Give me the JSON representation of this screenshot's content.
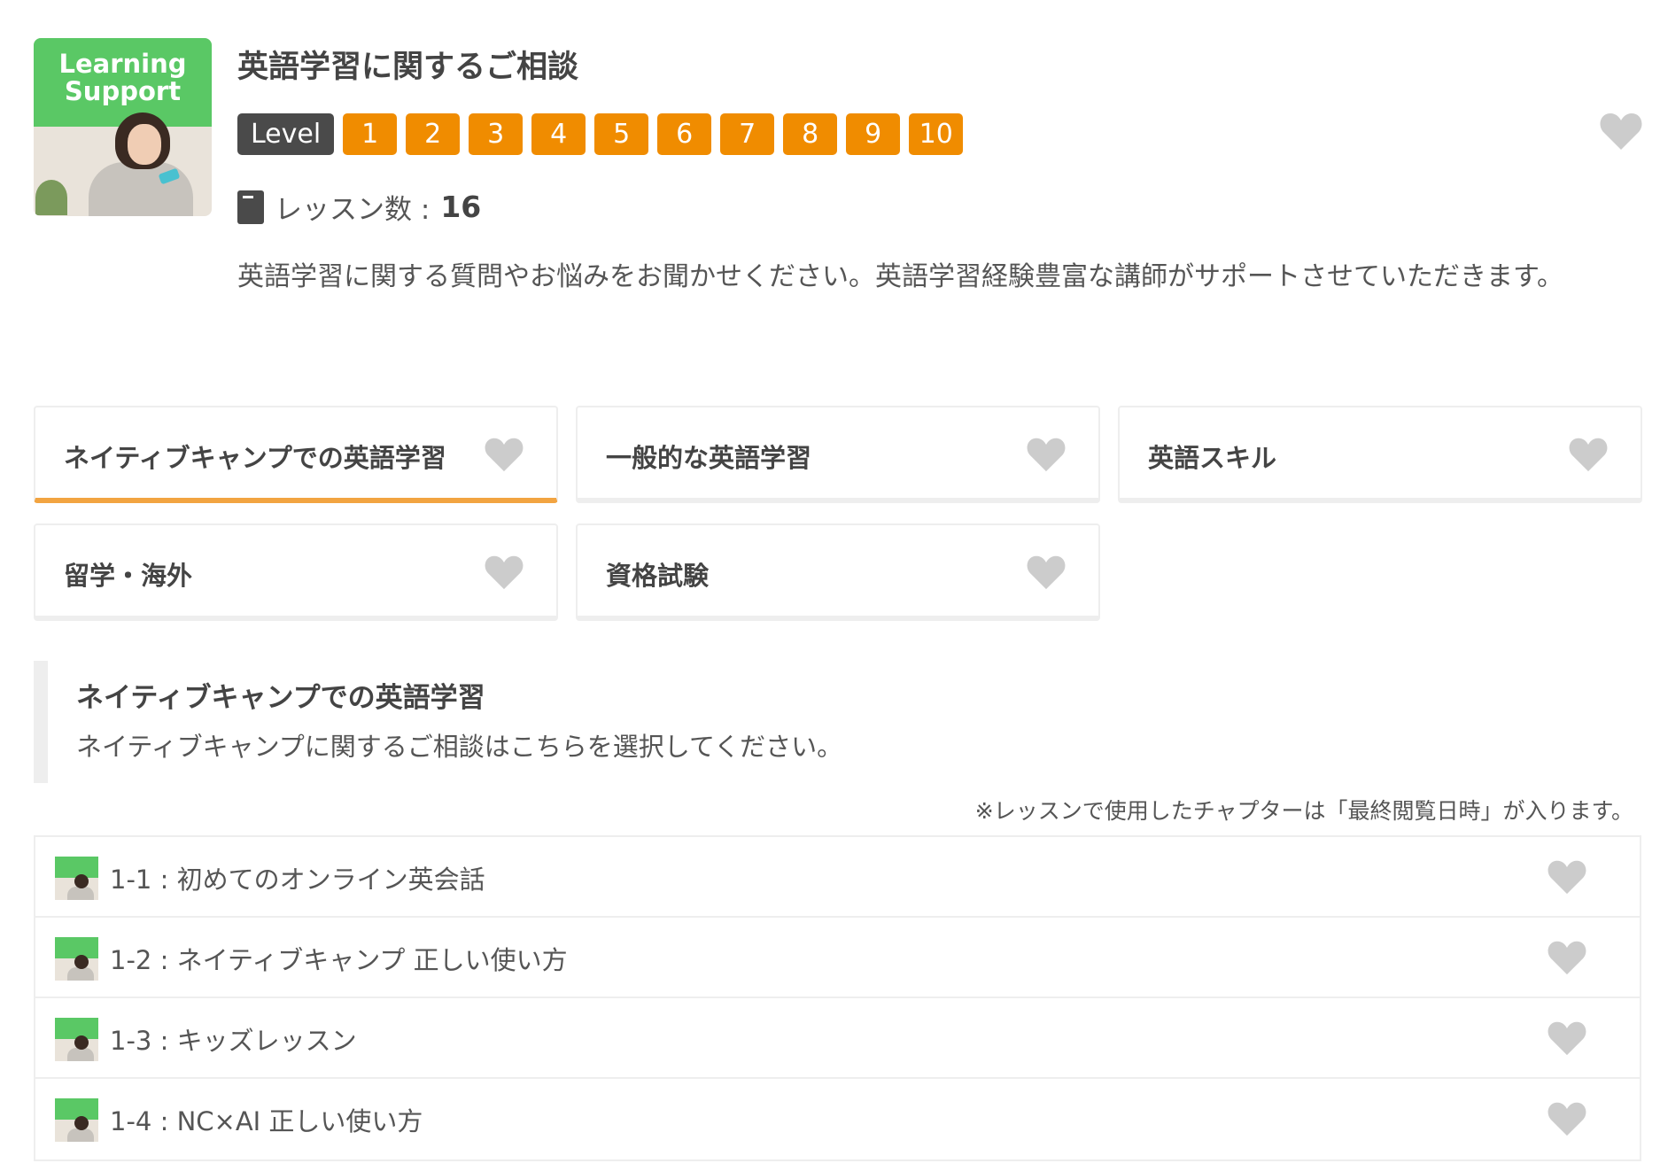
{
  "course": {
    "thumbnail_text": [
      "Learning",
      "Support"
    ],
    "title": "英語学習に関するご相談",
    "level_label": "Level",
    "levels": [
      "1",
      "2",
      "3",
      "4",
      "5",
      "6",
      "7",
      "8",
      "9",
      "10"
    ],
    "lesson_count_label": "レッスン数 : ",
    "lesson_count_value": "16",
    "description": "英語学習に関する質問やお悩みをお聞かせください。英語学習経験豊富な講師がサポートさせていただきます。"
  },
  "categories": [
    {
      "label": "ネイティブキャンプでの英語学習",
      "active": true
    },
    {
      "label": "一般的な英語学習",
      "active": false
    },
    {
      "label": "英語スキル",
      "active": false
    },
    {
      "label": "留学・海外",
      "active": false
    },
    {
      "label": "資格試験",
      "active": false
    }
  ],
  "section": {
    "title": "ネイティブキャンプでの英語学習",
    "description": "ネイティブキャンプに関するご相談はこちらを選択してください。"
  },
  "note": "※レッスンで使用したチャプターは「最終閲覧日時」が入ります。",
  "chapters": [
    {
      "label": "1-1 : 初めてのオンライン英会話"
    },
    {
      "label": "1-2 : ネイティブキャンプ 正しい使い方"
    },
    {
      "label": "1-3 : キッズレッスン"
    },
    {
      "label": "1-4 : NC×AI 正しい使い方"
    }
  ],
  "icons": {
    "favorite": "heart-icon",
    "lessons": "book-icon"
  },
  "colors": {
    "level_badge": "#f08c00",
    "level_label_bg": "#4a4a4a",
    "active_tab_underline": "#f2a441",
    "heart": "#cccccc",
    "thumbnail_green": "#5ac865"
  }
}
